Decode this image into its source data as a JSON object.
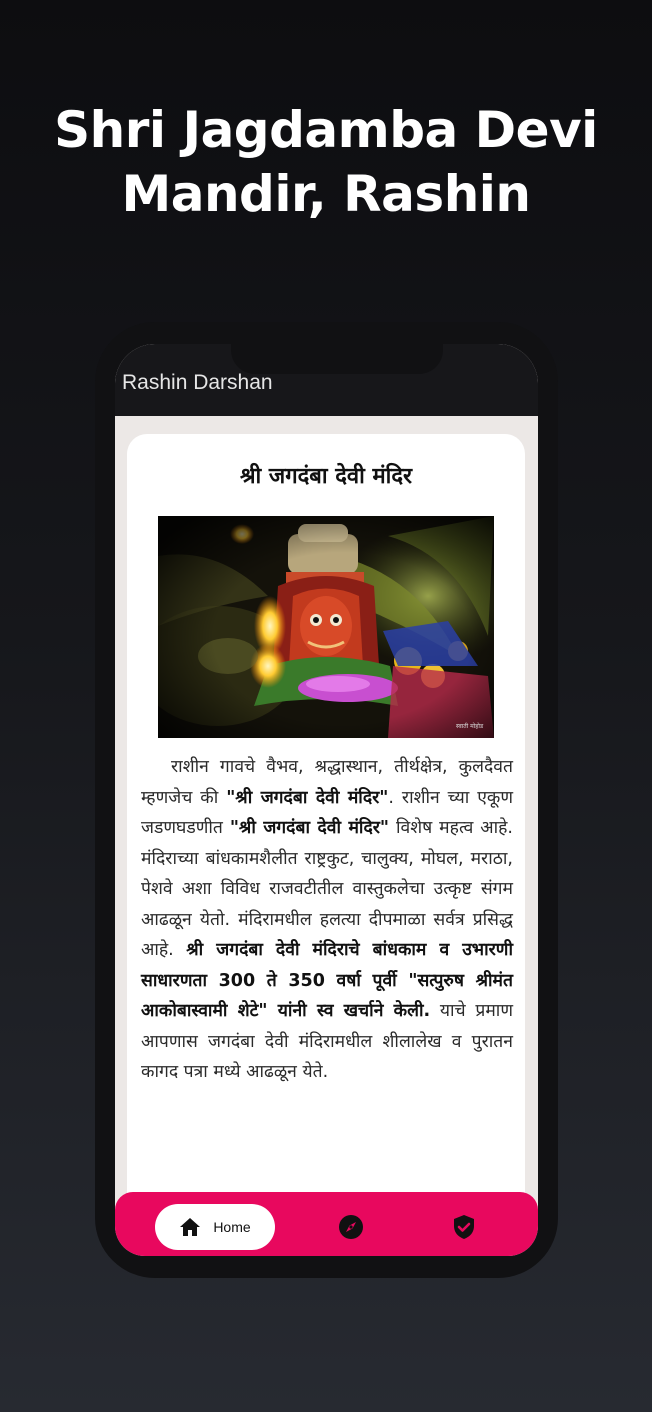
{
  "promo": {
    "title": "Shri Jagdamba Devi Mandir, Rashin"
  },
  "app": {
    "title": "Rashin Darshan"
  },
  "article": {
    "heading": "श्री जगदंबा देवी मंदिर",
    "photo_watermark": "स्वाती मोहोड",
    "p_intro": "राशीन गावचे वैभव, श्रद्धास्थान, तीर्थक्षेत्र, कुलदैवत म्हणजेच की ",
    "p_temple_name_1": "\"श्री जगदंबा देवी मंदिर\"",
    "p_mid": ". राशीन च्या एकूण जडणघडणीत ",
    "p_temple_name_2": "\"श्री जगदंबा देवी मंदिर\"",
    "p_architecture": " विशेष महत्व आहे. मंदिराच्या बांधकामशैलीत राष्ट्रकुट, चालुक्य, मोघल, मराठा, पेशवे अशा विविध राजवटीतील वास्तुकलेचा उत्कृष्ट संगम आढळून येतो. मंदिरामधील हलत्या दीपमाळा सर्वत्र प्रसिद्ध आहे. ",
    "p_construction": "श्री जगदंबा देवी मंदिराचे बांधकाम व उभारणी साधारणता 300 ते 350 वर्षा पूर्वी \"सत्पुरुष श्रीमंत आकोबास्वामी शेटे\" यांनी स्व खर्चाने केली.",
    "p_evidence": " याचे प्रमाण आपणास जगदंबा देवी मंदिरामधील शीलालेख व पुरातन कागद पत्रा मध्ये आढळून येते."
  },
  "nav": {
    "home_label": "Home",
    "home_icon": "home-icon",
    "explore_icon": "compass-icon",
    "verified_icon": "verified-shield-icon",
    "accent": "#e8085e"
  }
}
